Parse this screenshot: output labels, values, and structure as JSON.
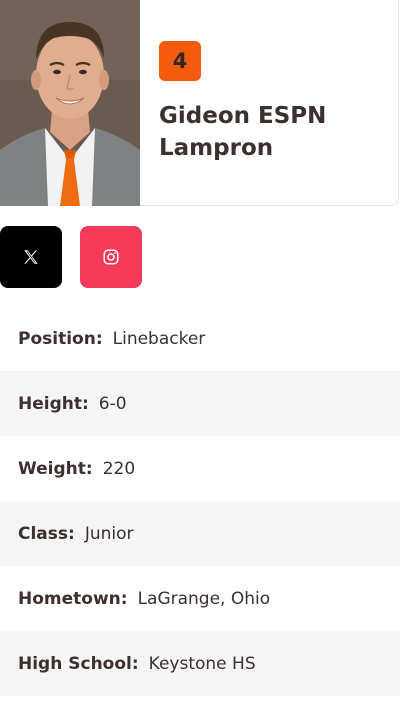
{
  "player": {
    "number": "4",
    "name_line1": "Gideon ESPN",
    "name_line2": "Lampron",
    "photo": "player-headshot"
  },
  "social": [
    {
      "icon": "x-twitter-icon",
      "color": "#000000"
    },
    {
      "icon": "instagram-icon",
      "color": "#f63a5a"
    }
  ],
  "details": [
    {
      "label": "Position:",
      "value": "Linebacker"
    },
    {
      "label": "Height:",
      "value": "6-0"
    },
    {
      "label": "Weight:",
      "value": "220"
    },
    {
      "label": "Class:",
      "value": "Junior"
    },
    {
      "label": "Hometown:",
      "value": "LaGrange, Ohio"
    },
    {
      "label": "High School:",
      "value": "Keystone HS"
    }
  ],
  "colors": {
    "accent": "#f45b0f",
    "instagram": "#f63a5a",
    "row_alt": "#f5f5f5"
  }
}
